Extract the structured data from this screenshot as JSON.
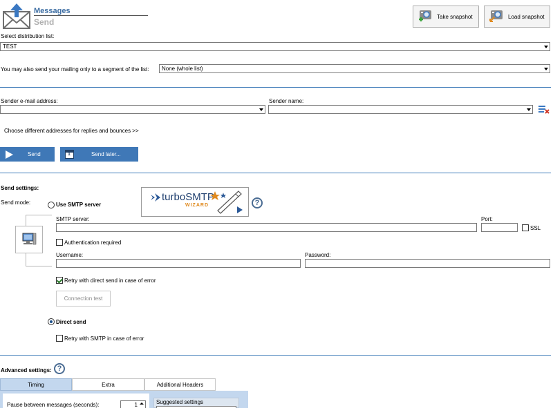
{
  "header": {
    "title": "Messages",
    "subtitle": "Send"
  },
  "toolbar": {
    "take_snapshot": "Take snapshot",
    "load_snapshot": "Load snapshot"
  },
  "distribution": {
    "label": "Select distribution list:",
    "value": "TEST"
  },
  "segment": {
    "label": "You may also send your mailing only to a segment of the list:",
    "value": "None (whole list)"
  },
  "sender": {
    "email_label": "Sender e-mail address:",
    "email_value": "",
    "name_label": "Sender name:",
    "name_value": "",
    "replies_link": "Choose different addresses for replies and bounces >>"
  },
  "actions": {
    "send": "Send",
    "send_later": "Send later...",
    "calendar_day": "1"
  },
  "send_settings": {
    "heading": "Send settings:",
    "mode_label": "Send mode:",
    "use_smtp": "Use SMTP server",
    "turbo_logo_text": "turboSMTP",
    "turbo_wizard_text": "WIZARD",
    "smtp_server_label": "SMTP server:",
    "smtp_server_value": "",
    "port_label": "Port:",
    "port_value": "",
    "ssl_label": "SSL",
    "auth_label": "Authentication required",
    "username_label": "Username:",
    "username_value": "",
    "password_label": "Password:",
    "password_value": "",
    "retry_direct_label": "Retry with direct send in case of error",
    "connection_test": "Connection test",
    "direct_send": "Direct send",
    "retry_smtp_label": "Retry with SMTP in case of error",
    "selected_mode": "direct_send",
    "auth_checked": false,
    "retry_direct_checked": true,
    "retry_smtp_checked": false,
    "ssl_checked": false
  },
  "advanced": {
    "heading": "Advanced settings:",
    "tabs": [
      "Timing",
      "Extra",
      "Additional Headers"
    ],
    "active_tab": "Timing",
    "pause_label": "Pause between messages (seconds):",
    "pause_value": "1",
    "suggested_label": "Suggested settings"
  },
  "colors": {
    "accent": "#3f78b7",
    "divider": "#3d7ab8",
    "tab_panel": "#c3d7ee"
  },
  "icons": {
    "help": "?"
  }
}
